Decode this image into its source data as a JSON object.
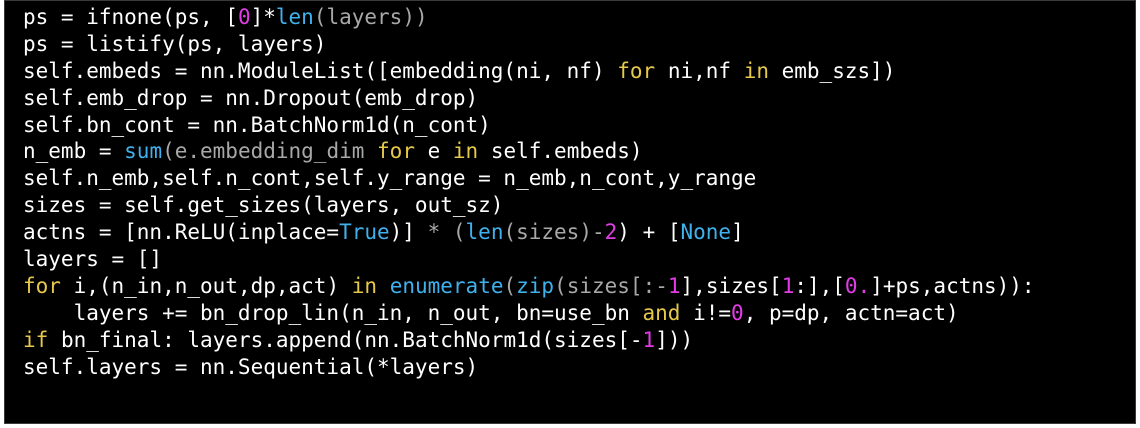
{
  "colors": {
    "background": "#000000",
    "text": "#ffffff",
    "keyword": "#e6c94a",
    "builtin": "#3fb2ee",
    "number": "#e23ce6",
    "dim": "#a8a8a8"
  },
  "code": {
    "lines": [
      [
        [
          "plain",
          "ps = ifnone(ps, ["
        ],
        [
          "num",
          "0"
        ],
        [
          "plain",
          "]*"
        ],
        [
          "builtin",
          "len"
        ],
        [
          "dim",
          "(layers))"
        ]
      ],
      [
        [
          "plain",
          "ps = listify(ps, layers)"
        ]
      ],
      [
        [
          "plain",
          "self.embeds = nn.ModuleList([embedding(ni, nf) "
        ],
        [
          "kw",
          "for"
        ],
        [
          "plain",
          " ni,nf "
        ],
        [
          "kw",
          "in"
        ],
        [
          "plain",
          " emb_szs])"
        ]
      ],
      [
        [
          "plain",
          "self.emb_drop = nn.Dropout(emb_drop)"
        ]
      ],
      [
        [
          "plain",
          "self.bn_cont = nn.BatchNorm1d(n_cont)"
        ]
      ],
      [
        [
          "plain",
          "n_emb = "
        ],
        [
          "builtin",
          "sum"
        ],
        [
          "dim",
          "(e.embedding_dim "
        ],
        [
          "kw",
          "for"
        ],
        [
          "plain",
          " e "
        ],
        [
          "kw",
          "in"
        ],
        [
          "plain",
          " self.embeds)"
        ]
      ],
      [
        [
          "plain",
          "self.n_emb,self.n_cont,self.y_range = n_emb,n_cont,y_range"
        ]
      ],
      [
        [
          "plain",
          "sizes = self.get_sizes(layers, out_sz)"
        ]
      ],
      [
        [
          "plain",
          "actns = [nn.ReLU(inplace="
        ],
        [
          "builtin",
          "True"
        ],
        [
          "plain",
          ")] "
        ],
        [
          "dim",
          "* ("
        ],
        [
          "builtin",
          "len"
        ],
        [
          "dim",
          "(sizes)-"
        ],
        [
          "num",
          "2"
        ],
        [
          "plain",
          ") + ["
        ],
        [
          "builtin",
          "None"
        ],
        [
          "plain",
          "]"
        ]
      ],
      [
        [
          "plain",
          "layers = []"
        ]
      ],
      [
        [
          "kw",
          "for"
        ],
        [
          "plain",
          " i,(n_in,n_out,dp,act) "
        ],
        [
          "kw",
          "in"
        ],
        [
          "plain",
          " "
        ],
        [
          "builtin",
          "enumerate"
        ],
        [
          "dim",
          "("
        ],
        [
          "builtin",
          "zip"
        ],
        [
          "dim",
          "(sizes[:-"
        ],
        [
          "num",
          "1"
        ],
        [
          "plain",
          "],sizes["
        ],
        [
          "num",
          "1"
        ],
        [
          "plain",
          ":],["
        ],
        [
          "num",
          "0."
        ],
        [
          "plain",
          "]+ps,actns)):"
        ]
      ],
      [
        [
          "plain",
          "    layers += bn_drop_lin(n_in, n_out, bn=use_bn "
        ],
        [
          "kw",
          "and"
        ],
        [
          "plain",
          " i!="
        ],
        [
          "num",
          "0"
        ],
        [
          "plain",
          ", p=dp, actn=act)"
        ]
      ],
      [
        [
          "kw",
          "if"
        ],
        [
          "plain",
          " bn_final: layers.append(nn.BatchNorm1d(sizes[-"
        ],
        [
          "num",
          "1"
        ],
        [
          "plain",
          "]))"
        ]
      ],
      [
        [
          "plain",
          "self.layers = nn.Sequential(*layers)"
        ]
      ]
    ]
  }
}
